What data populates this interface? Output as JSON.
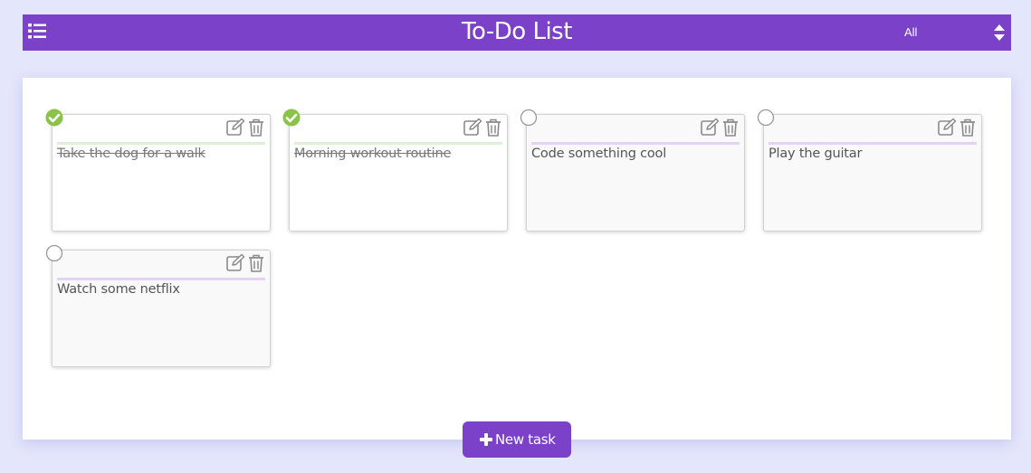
{
  "header": {
    "title": "To-Do List",
    "filter_value": "All",
    "accent_color": "#7b41c9"
  },
  "tasks": [
    {
      "text": "Take the dog for a walk",
      "completed": true
    },
    {
      "text": "Morning workout routine",
      "completed": true
    },
    {
      "text": "Code something cool",
      "completed": false
    },
    {
      "text": "Play the guitar",
      "completed": false
    },
    {
      "text": "Watch some netflix",
      "completed": false
    }
  ],
  "icons": {
    "menu": "list-menu-icon",
    "edit": "edit-icon",
    "delete": "trash-icon",
    "done": "check-circle-icon",
    "pending": "empty-circle-icon",
    "sort": "sort-arrows-icon",
    "add": "plus-icon"
  },
  "colors": {
    "done_check": "#8bc34a",
    "done_divider": "#deefd7",
    "todo_divider": "#e3d2f3"
  },
  "actions": {
    "new_task_label": "New task"
  }
}
